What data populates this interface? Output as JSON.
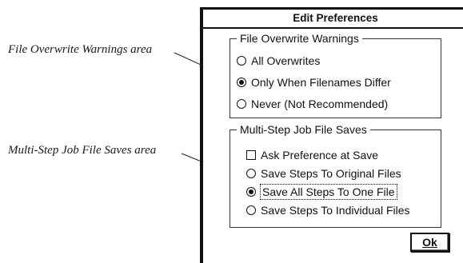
{
  "callouts": {
    "overwrite_area": "File Overwrite Warnings area",
    "multistep_area": "Multi-Step Job File Saves area"
  },
  "dialog": {
    "title": "Edit Preferences",
    "overwrite_group": {
      "title": "File Overwrite Warnings",
      "options": [
        {
          "label": "All Overwrites",
          "selected": false
        },
        {
          "label": "Only When Filenames Differ",
          "selected": true
        },
        {
          "label": "Never (Not Recommended)",
          "selected": false
        }
      ]
    },
    "multistep_group": {
      "title": "Multi-Step Job File Saves",
      "ask_checkbox": {
        "label": "Ask Preference at Save",
        "checked": false
      },
      "options": [
        {
          "label": "Save Steps To Original Files",
          "selected": false
        },
        {
          "label": "Save All Steps To One File",
          "selected": true
        },
        {
          "label": "Save Steps To Individual Files",
          "selected": false
        }
      ]
    },
    "ok_label": "Ok"
  }
}
